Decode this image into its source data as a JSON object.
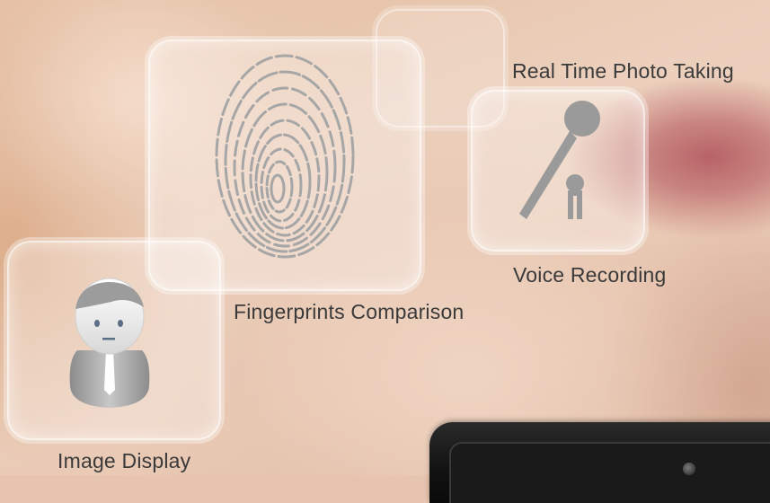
{
  "features": {
    "photo_label": "Real Time Photo Taking",
    "voice_label": "Voice Recording",
    "fingerprint_label": "Fingerprints Comparison",
    "image_label": "Image Display"
  },
  "icons": {
    "fingerprint": "fingerprint-icon",
    "microphone": "microphone-icon",
    "person": "person-icon"
  },
  "colors": {
    "label_text": "#3a3a3a",
    "icon_gray": "#9a9a9a"
  }
}
